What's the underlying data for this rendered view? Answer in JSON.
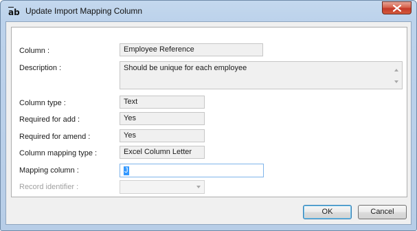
{
  "window": {
    "title": "Update Import Mapping Column",
    "icon": "text-field-ab-icon",
    "close_icon": "close-x-icon"
  },
  "fields": {
    "column": {
      "label": "Column :",
      "value": "Employee Reference"
    },
    "description": {
      "label": "Description :",
      "value": "Should be unique for each employee"
    },
    "column_type": {
      "label": "Column type :",
      "value": "Text"
    },
    "required_add": {
      "label": "Required for add  :",
      "value": "Yes"
    },
    "required_amend": {
      "label": "Required for amend :",
      "value": "Yes"
    },
    "mapping_type": {
      "label": "Column mapping type :",
      "value": "Excel Column Letter"
    },
    "mapping_column": {
      "label": "Mapping column :",
      "value": "J"
    },
    "record_identifier": {
      "label": "Record identifier :",
      "value": ""
    }
  },
  "buttons": {
    "ok": "OK",
    "cancel": "Cancel"
  },
  "colors": {
    "frame": "#bcd2eb",
    "close_button": "#c4392a",
    "selection": "#3399ff",
    "focus_border": "#7eb4ea"
  }
}
